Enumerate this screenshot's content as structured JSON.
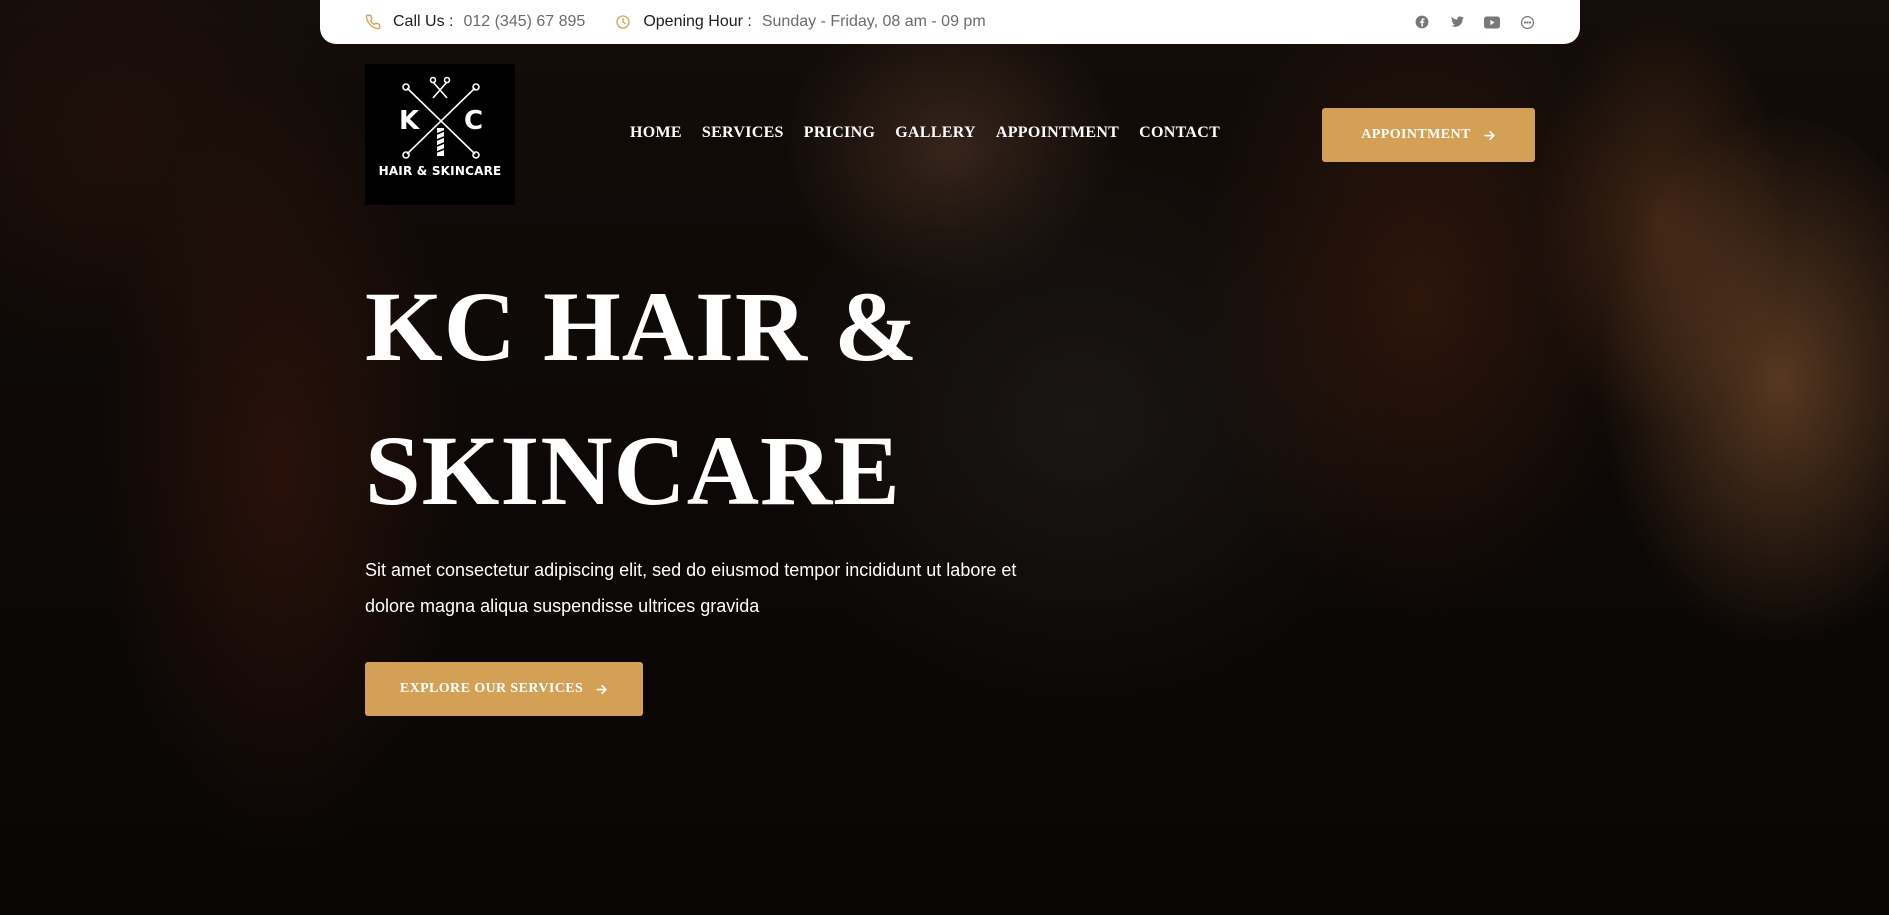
{
  "topbar": {
    "call_label": "Call Us :",
    "call_value": "012 (345) 67 895",
    "hours_label": "Opening Hour :",
    "hours_value": "Sunday - Friday, 08 am - 09 pm",
    "icon_color": "#d4a056",
    "socials": [
      "facebook-icon",
      "twitter-icon",
      "youtube-icon",
      "messenger-icon"
    ]
  },
  "logo": {
    "letter_left": "K",
    "letter_right": "C",
    "tagline": "HAIR & SKINCARE"
  },
  "nav": {
    "items": [
      "HOME",
      "SERVICES",
      "PRICING",
      "GALLERY",
      "APPOINTMENT",
      "CONTACT"
    ]
  },
  "header": {
    "appointment_label": "APPOINTMENT"
  },
  "hero": {
    "title_line1": "KC HAIR &",
    "title_line2": "SKINCARE",
    "description": "Sit amet consectetur adipiscing elit, sed do eiusmod tempor incididunt ut labore et dolore magna aliqua suspendisse ultrices gravida",
    "cta_label": "EXPLORE OUR SERVICES"
  },
  "colors": {
    "accent": "#d4a056",
    "text_light": "#ffffff",
    "topbar_bg": "#ffffff"
  }
}
